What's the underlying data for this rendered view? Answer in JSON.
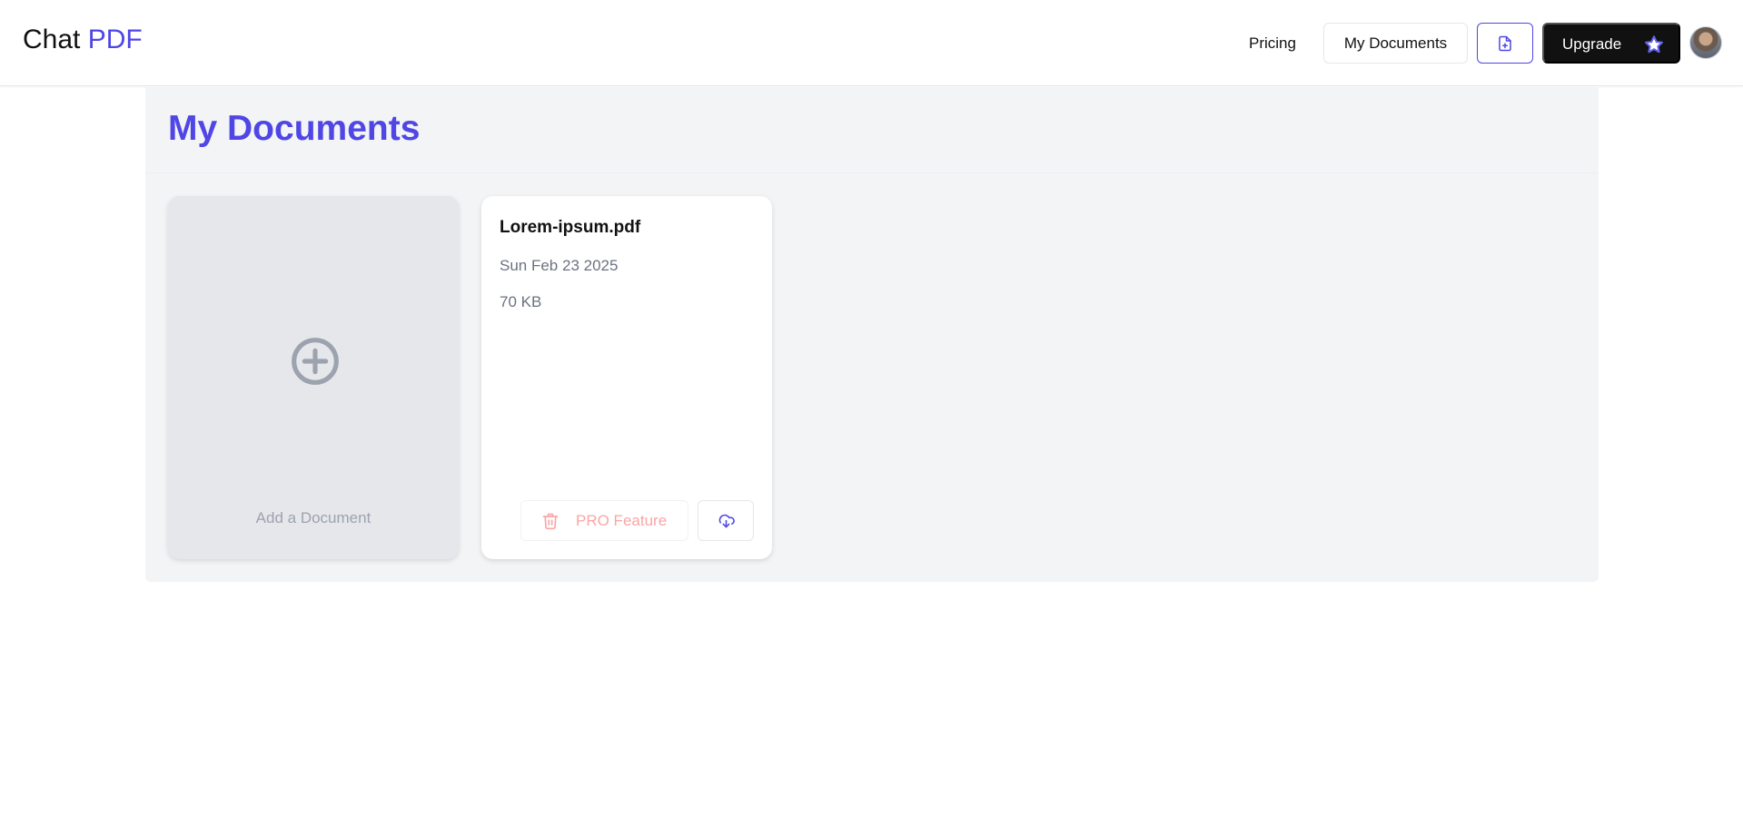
{
  "header": {
    "logo_main": "Chat",
    "logo_accent": "PDF",
    "nav_pricing": "Pricing",
    "nav_my_documents": "My Documents",
    "upgrade_label": "Upgrade",
    "upload_icon": "file-plus-icon",
    "upgrade_icon": "star-icon",
    "accent_color": "#4f46e5"
  },
  "page": {
    "title": "My Documents"
  },
  "add_card": {
    "label": "Add a Document",
    "icon": "plus-circle-icon"
  },
  "documents": [
    {
      "name": "Lorem-ipsum.pdf",
      "date": "Sun Feb 23 2025",
      "size": "70 KB",
      "delete_label": "PRO Feature",
      "delete_icon": "trash-icon",
      "download_icon": "cloud-download-icon"
    }
  ]
}
